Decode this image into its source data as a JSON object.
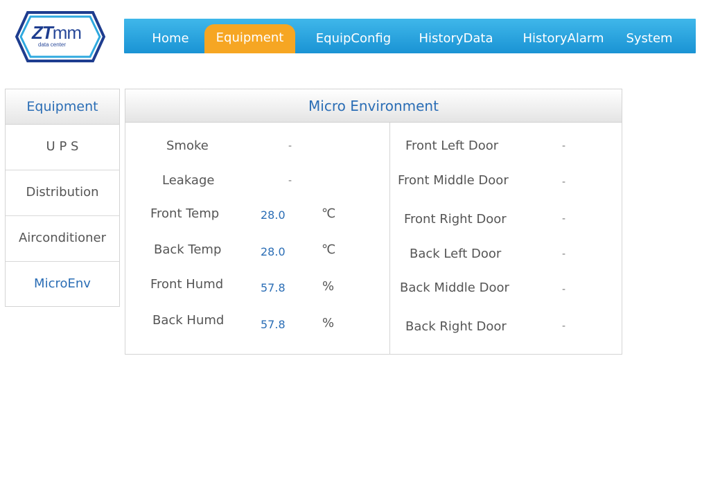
{
  "logo": {
    "main": "ZT",
    "thin": "mm",
    "sub": "data center"
  },
  "topnav": {
    "items": [
      {
        "label": "Home"
      },
      {
        "label": "Equipment"
      },
      {
        "label": "EquipConfig"
      },
      {
        "label": "HistoryData"
      },
      {
        "label": "HistoryAlarm"
      },
      {
        "label": "System"
      }
    ],
    "active_index": 1
  },
  "sidemenu": {
    "title": "Equipment",
    "items": [
      {
        "label": "U P S"
      },
      {
        "label": "Distribution"
      },
      {
        "label": "Airconditioner"
      },
      {
        "label": "MicroEnv"
      }
    ],
    "active_index": 3
  },
  "panel": {
    "title": "Micro Environment",
    "left": [
      {
        "label": "Smoke",
        "value": "-",
        "unit": ""
      },
      {
        "label": "Leakage",
        "value": "-",
        "unit": ""
      },
      {
        "label": "Front Temp",
        "value": "28.0",
        "unit": "℃"
      },
      {
        "label": "Back Temp",
        "value": "28.0",
        "unit": "℃"
      },
      {
        "label": "Front Humd",
        "value": "57.8",
        "unit": "%"
      },
      {
        "label": "Back Humd",
        "value": "57.8",
        "unit": "%"
      }
    ],
    "right": [
      {
        "label": "Front Left Door",
        "value": "-"
      },
      {
        "label": "Front Middle Door",
        "value": "-"
      },
      {
        "label": "Front Right Door",
        "value": "-"
      },
      {
        "label": "Back Left Door",
        "value": "-"
      },
      {
        "label": "Back Middle Door",
        "value": "-"
      },
      {
        "label": "Back Right Door",
        "value": "-"
      }
    ]
  },
  "colors": {
    "nav_blue": "#1a93d4",
    "nav_active": "#f6a623",
    "accent_text": "#2a6db5"
  }
}
